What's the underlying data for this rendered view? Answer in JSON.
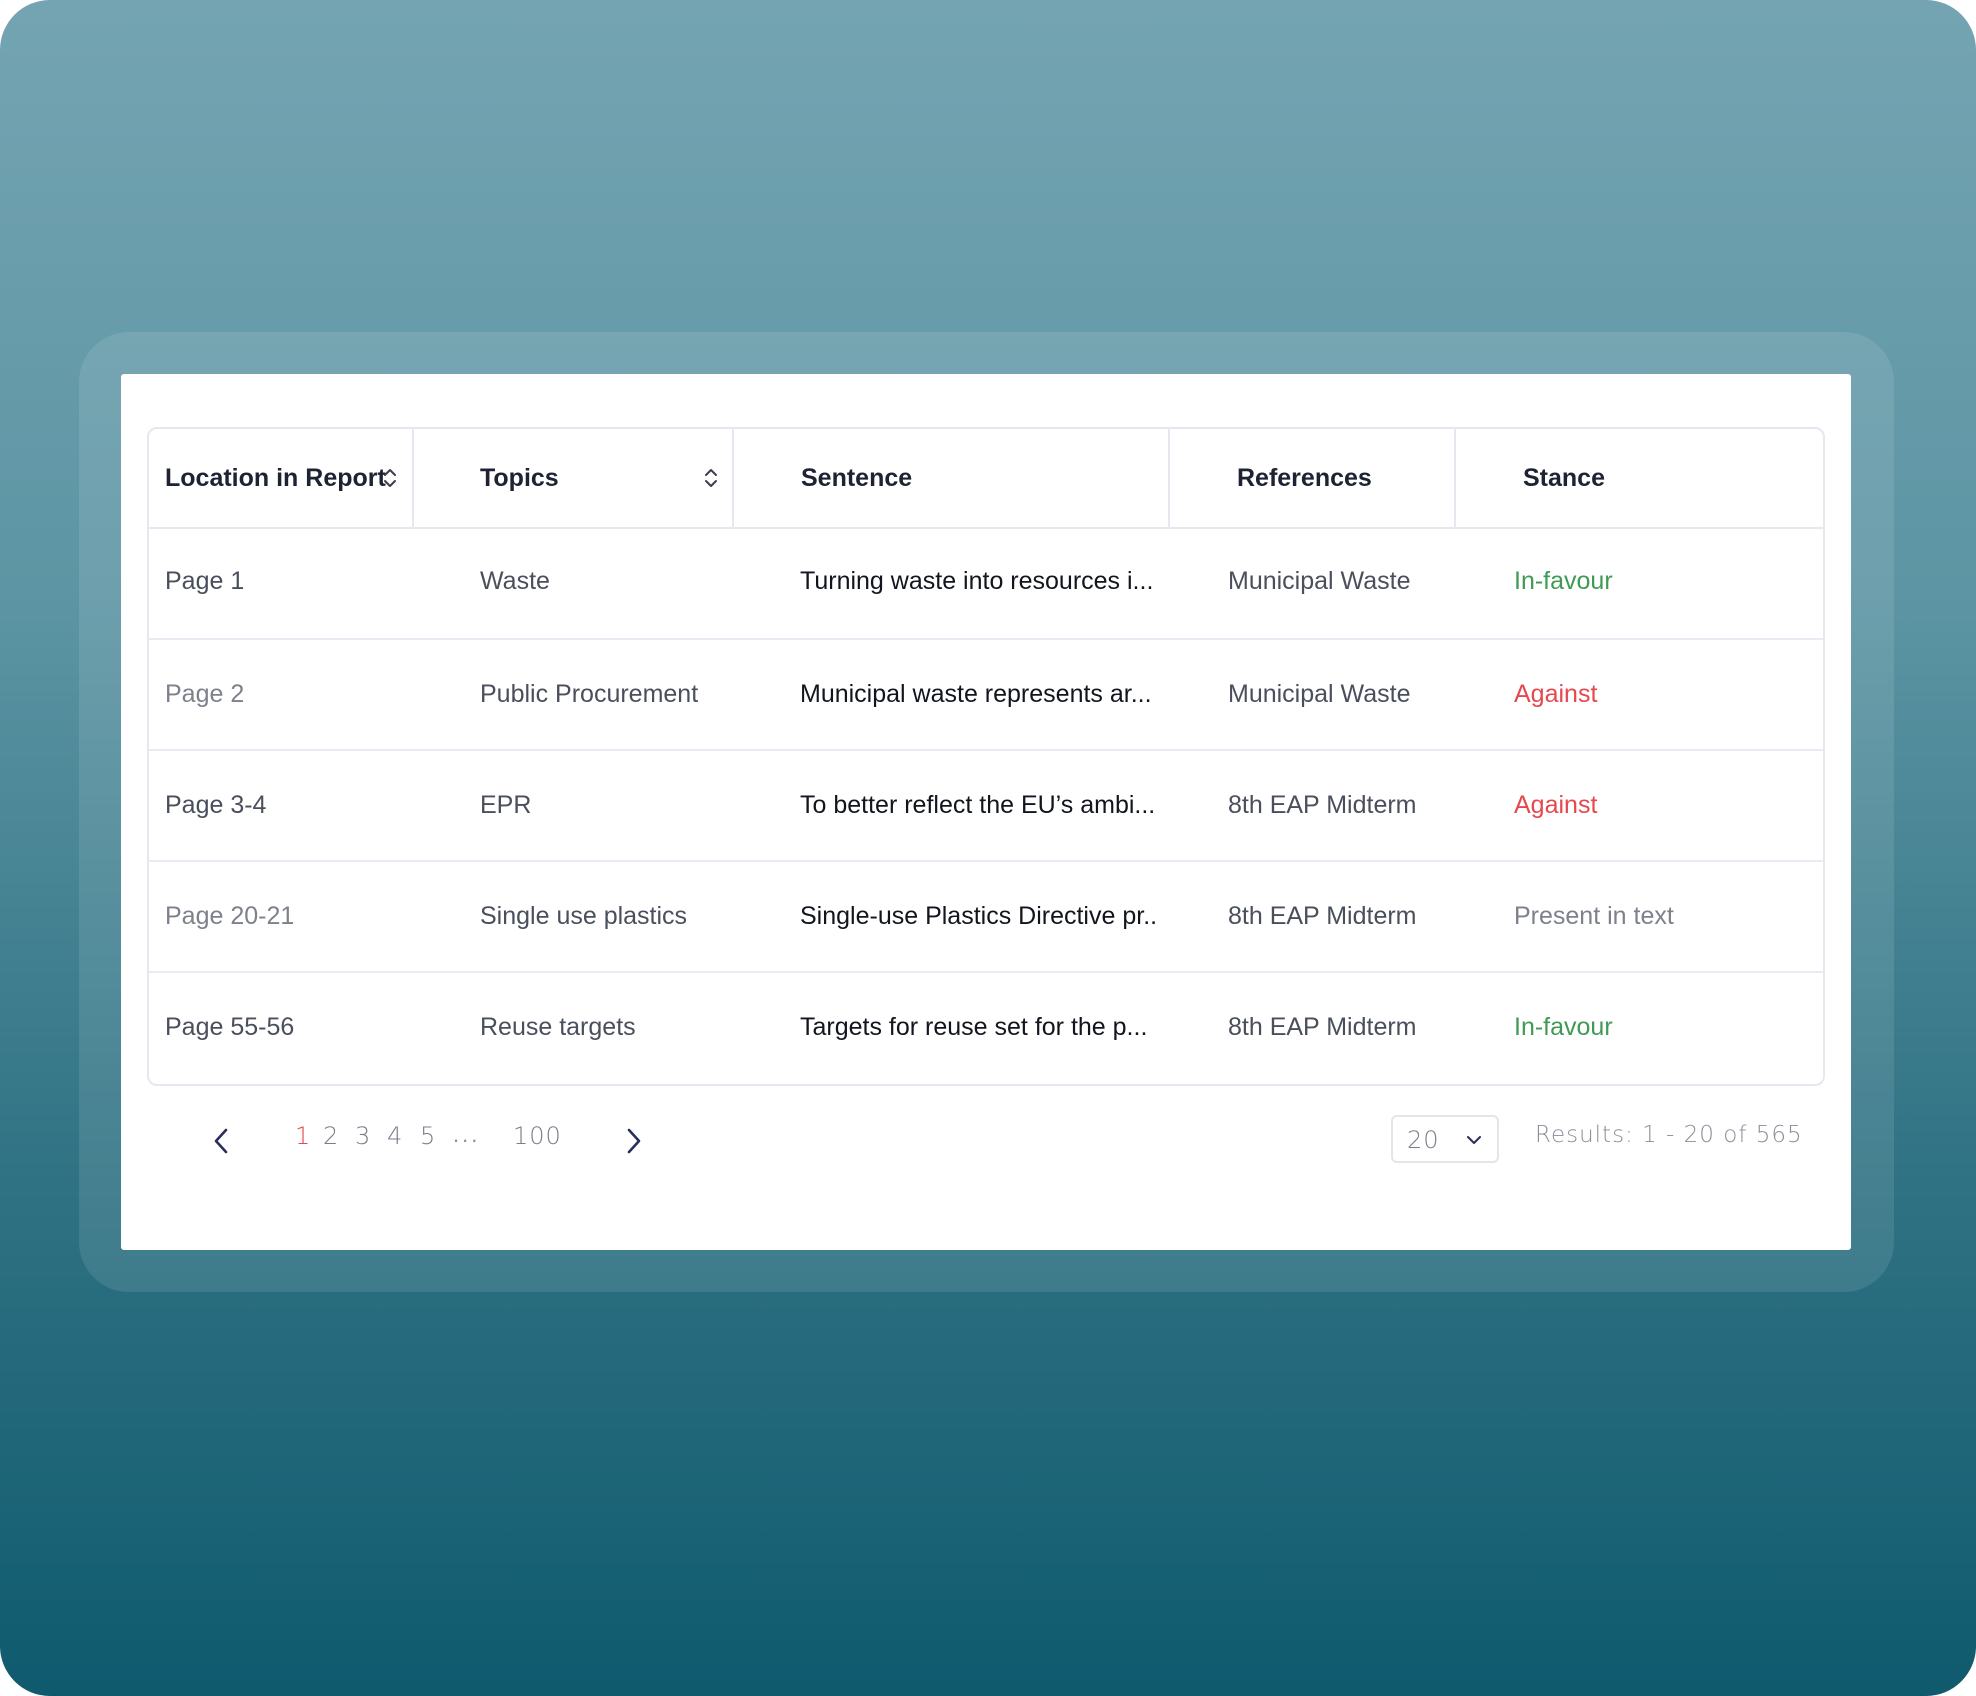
{
  "table": {
    "columns": [
      {
        "label": "Location in Report",
        "sortable": true
      },
      {
        "label": "Topics",
        "sortable": true
      },
      {
        "label": "Sentence",
        "sortable": false
      },
      {
        "label": "References",
        "sortable": false
      },
      {
        "label": "Stance",
        "sortable": false
      }
    ],
    "rows": [
      {
        "location": "Page 1",
        "topic": "Waste",
        "sentence": "Turning waste into resources i...",
        "reference": "Municipal Waste",
        "stance": "In-favour",
        "stance_color": "#3f9a55"
      },
      {
        "location": "Page 2",
        "topic": "Public Procurement",
        "sentence": "Municipal waste represents ar...",
        "reference": "Municipal Waste",
        "stance": "Against",
        "stance_color": "#e5484d"
      },
      {
        "location": "Page 3-4",
        "topic": "EPR",
        "sentence": "To better reflect the EU’s ambi...",
        "reference": "8th EAP Midterm",
        "stance": "Against",
        "stance_color": "#e5484d"
      },
      {
        "location": "Page 20-21",
        "topic": "Single use plastics",
        "sentence": "Single-use Plastics Directive pr..",
        "reference": "8th EAP Midterm",
        "stance": "Present in text",
        "stance_color": "#7d818b"
      },
      {
        "location": "Page 55-56",
        "topic": "Reuse targets",
        "sentence": "Targets for reuse set for the p...",
        "reference": "8th EAP Midterm",
        "stance": "In-favour",
        "stance_color": "#3f9a55"
      }
    ]
  },
  "pagination": {
    "pages": [
      "1",
      "2",
      "3",
      "4",
      "5"
    ],
    "active_page": "1",
    "ellipsis": "...",
    "last_page": "100",
    "prev_icon": "chevron-left-icon",
    "next_icon": "chevron-right-icon",
    "page_size": "20",
    "results_text": "Results: 1 - 20 of 565"
  },
  "colors": {
    "accent": "#e5484d",
    "positive": "#3f9a55",
    "neutral": "#7d818b"
  }
}
